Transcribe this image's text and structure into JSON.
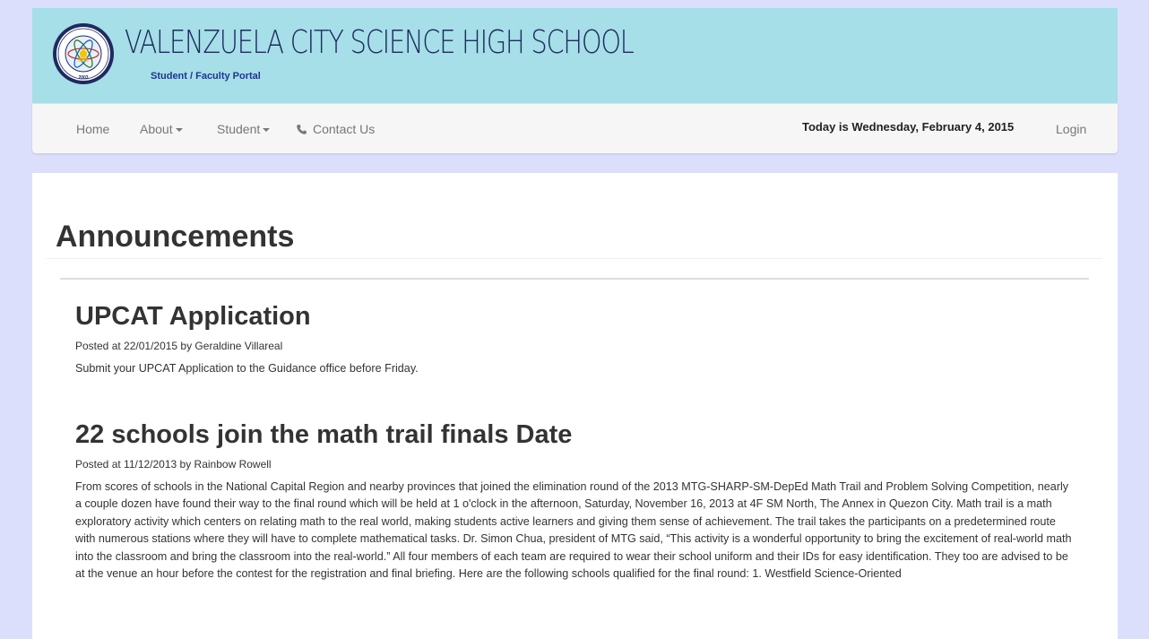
{
  "header": {
    "school_name": "VALENZUELA CITY SCIENCE HIGH SCHOOL",
    "portal_subtitle": "Student / Faculty Portal",
    "seal_year": "2003"
  },
  "nav": {
    "home": "Home",
    "about": "About",
    "student": "Student",
    "contact": "Contact Us",
    "today": "Today is Wednesday, February 4, 2015",
    "login": "Login"
  },
  "main": {
    "title": "Announcements",
    "posts": [
      {
        "title": "UPCAT Application",
        "meta": "Posted at 22/01/2015 by Geraldine Villareal",
        "body": "Submit your UPCAT Application to the Guidance office before Friday."
      },
      {
        "title": "22 schools join the math trail finals Date",
        "meta": "Posted at 11/12/2013 by Rainbow Rowell",
        "body": "From scores of schools in the National Capital Region and nearby provinces that joined the elimination round of the 2013 MTG-SHARP-SM-DepEd Math Trail and Problem Solving Competition, nearly a couple dozen have found their way to the final round which will be held at 1 o'clock in the afternoon, Saturday, November 16, 2013 at 4F SM North, The Annex in Quezon City. Math trail is a math exploratory activity which centers on relating math to the real world, making students active learners and giving them sense of achievement. The trail takes the participants on a predetermined route with numerous stations where they will have to complete mathematical tasks. Dr. Simon Chua, president of MTG said, “This activity is a wonderful opportunity to bring the excitement of real-world math into the classroom and bring the classroom into the real-world.” All four members of each team are required to wear their school uniform and their IDs for easy identification. They too are advised to be at the venue an hour before the contest for the registration and final briefing. Here are the following schools qualified for the final round: 1. Westfield Science-Oriented"
      }
    ]
  },
  "colors": {
    "banner_bg": "#a6dfe7",
    "page_bg": "#dcdffc",
    "title_navy": "#1e2a60",
    "subtitle_blue": "#1e3592"
  }
}
